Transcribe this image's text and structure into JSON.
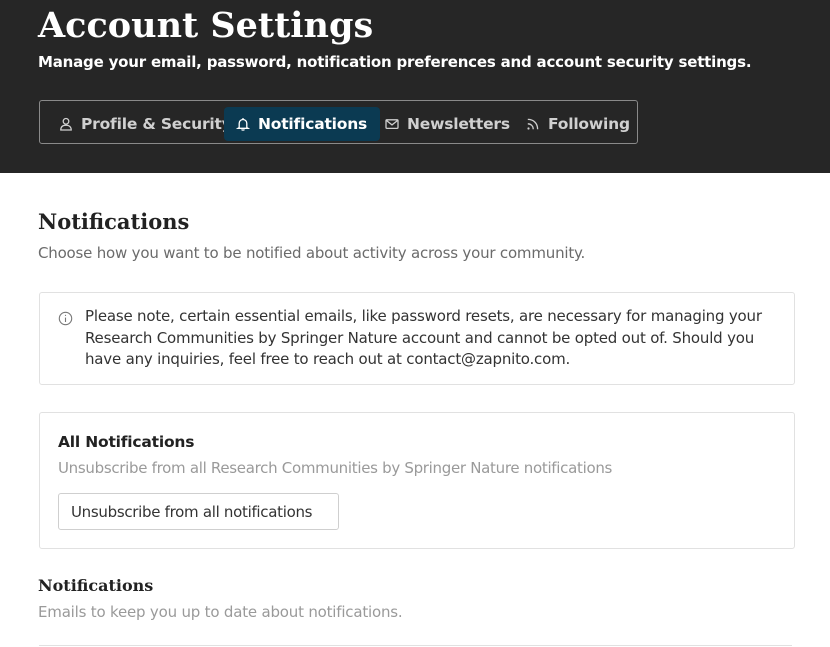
{
  "header": {
    "title": "Account Settings",
    "subtitle": "Manage your email, password, notification preferences and account security settings."
  },
  "tabs": [
    {
      "label": "Profile & Security",
      "icon": "user-icon",
      "active": false
    },
    {
      "label": "Notifications",
      "icon": "bell-icon",
      "active": true
    },
    {
      "label": "Newsletters",
      "icon": "envelope-icon",
      "active": false
    },
    {
      "label": "Following",
      "icon": "rss-icon",
      "active": false
    }
  ],
  "main": {
    "title": "Notifications",
    "subtitle": "Choose how you want to be notified about activity across your community.",
    "notice": {
      "icon": "info-icon",
      "text": "Please note, certain essential emails, like password resets, are necessary for managing your Research Communities by Springer Nature account and cannot be opted out of. Should you have any inquiries, feel free to reach out at contact@zapnito.com."
    },
    "all_notifications": {
      "title": "All Notifications",
      "description": "Unsubscribe from all Research Communities by Springer Nature notifications",
      "button_label": "Unsubscribe from all notifications"
    },
    "section": {
      "title": "Notifications",
      "subtitle": "Emails to keep you up to date about notifications."
    }
  },
  "colors": {
    "header_bg": "#262626",
    "active_tab_bg": "#0b3a52",
    "border": "#e1e1e1",
    "muted_text": "#9a9a9a"
  }
}
